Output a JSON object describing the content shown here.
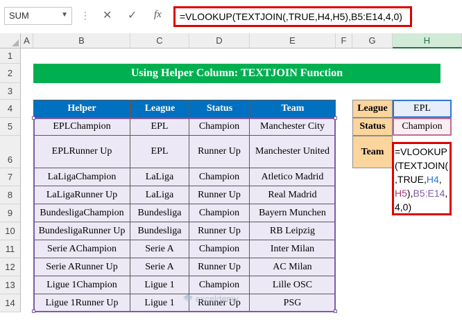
{
  "formula_bar": {
    "name_box": "SUM",
    "formula": "=VLOOKUP(TEXTJOIN(,TRUE,H4,H5),B5:E14,4,0)"
  },
  "columns": [
    "A",
    "B",
    "C",
    "D",
    "E",
    "F",
    "G",
    "H"
  ],
  "rows": [
    "1",
    "2",
    "3",
    "4",
    "5",
    "6",
    "7",
    "8",
    "9",
    "10",
    "11",
    "12",
    "13",
    "14"
  ],
  "title": "Using Helper Column: TEXTJOIN Function",
  "table": {
    "headers": [
      "Helper",
      "League",
      "Status",
      "Team"
    ],
    "rows": [
      [
        "EPLChampion",
        "EPL",
        "Champion",
        "Manchester City"
      ],
      [
        "EPLRunner Up",
        "EPL",
        "Runner Up",
        "Manchester United"
      ],
      [
        "LaLigaChampion",
        "LaLiga",
        "Champion",
        "Atletico Madrid"
      ],
      [
        "LaLigaRunner Up",
        "LaLiga",
        "Runner Up",
        "Real Madrid"
      ],
      [
        "BundesligaChampion",
        "Bundesliga",
        "Champion",
        "Bayern Munchen"
      ],
      [
        "BundesligaRunner Up",
        "Bundesliga",
        "Runner Up",
        "RB Leipzig"
      ],
      [
        "Serie AChampion",
        "Serie A",
        "Champion",
        "Inter Milan"
      ],
      [
        "Serie ARunner Up",
        "Serie A",
        "Runner Up",
        "AC Milan"
      ],
      [
        "Ligue 1Champion",
        "Ligue 1",
        "Champion",
        "Lille OSC"
      ],
      [
        "Ligue 1Runner Up",
        "Ligue 1",
        "Runner Up",
        "PSG"
      ]
    ]
  },
  "lookup": {
    "league_label": "League",
    "league_value": "EPL",
    "status_label": "Status",
    "status_value": "Champion",
    "team_label": "Team",
    "edit_parts": {
      "p1": "=VLOOKUP",
      "p2": "(TEXTJOIN(",
      "p3": ",TRUE,",
      "p4": "H4",
      "p5": ",",
      "p6": "H5",
      "p7": "),",
      "p8": "B5:E14",
      "p9": ",",
      "p10": "4,0)"
    }
  },
  "colors": {
    "title_bg": "#00b050",
    "header_bg": "#0070c0",
    "table_bg": "#ece8f5",
    "label_bg": "#fcd59d",
    "ref_h4": "#2e75d6",
    "ref_h5": "#a53a6e",
    "ref_range": "#7e5aa8",
    "highlight": "#e00000"
  },
  "watermark": "exceldemy"
}
